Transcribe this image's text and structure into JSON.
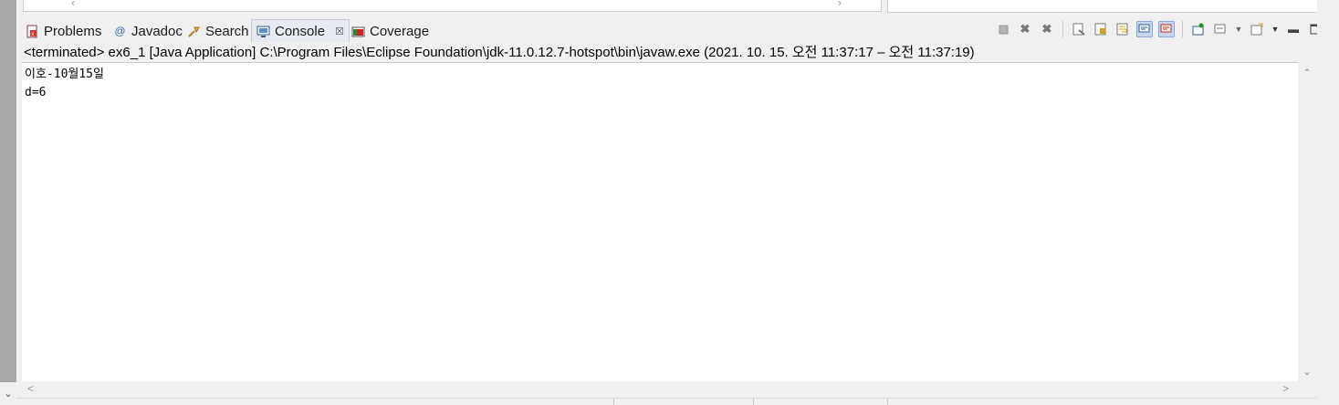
{
  "tabs": [
    {
      "label": "Problems",
      "icon": "problems-icon"
    },
    {
      "label": "Javadoc",
      "icon": "javadoc-icon"
    },
    {
      "label": "Search",
      "icon": "search-icon"
    },
    {
      "label": "Console",
      "icon": "console-icon",
      "active": true
    },
    {
      "label": "Coverage",
      "icon": "coverage-icon"
    }
  ],
  "status_line": "<terminated> ex6_1 [Java Application] C:\\Program Files\\Eclipse Foundation\\jdk-11.0.12.7-hotspot\\bin\\javaw.exe  (2021. 10. 15. 오전 11:37:17 – 오전 11:37:19)",
  "console_output": [
    "이호-10월15일",
    "d=6"
  ],
  "toolbar_icons": [
    "terminate-icon",
    "remove-launch-icon",
    "remove-all-terminated-icon",
    "clear-console-icon",
    "scroll-lock-icon",
    "word-wrap-icon",
    "show-on-stdout-icon",
    "show-on-stderr-icon",
    "pin-console-icon",
    "display-selected-console-icon",
    "open-console-icon",
    "minimize-icon",
    "maximize-icon"
  ],
  "colors": {
    "active_tab_bg": "#e7eaf0",
    "toolbar_active_bg": "#c4d6ee",
    "left_strip": "#a7a7a7"
  }
}
